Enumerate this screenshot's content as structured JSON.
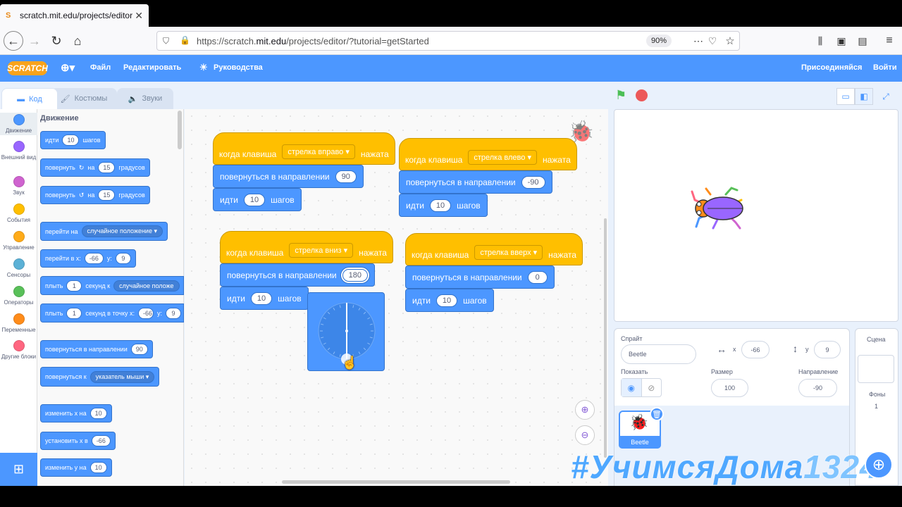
{
  "browser": {
    "tab_title": "scratch.mit.edu/projects/editor",
    "url_prefix": "https://scratch.",
    "url_domain": "mit.edu",
    "url_suffix": "/projects/editor/?tutorial=getStarted",
    "zoom": "90%"
  },
  "menu": {
    "logo": "SCRATCH",
    "file": "Файл",
    "edit": "Редактировать",
    "tutorials": "Руководства",
    "join": "Присоединяйся",
    "login": "Войти"
  },
  "tabs": {
    "code": "Код",
    "costumes": "Костюмы",
    "sounds": "Звуки"
  },
  "categories": [
    {
      "label": "Движение",
      "color": "#4c97ff"
    },
    {
      "label": "Внешний вид",
      "color": "#9966ff"
    },
    {
      "label": "Звук",
      "color": "#cf63cf"
    },
    {
      "label": "События",
      "color": "#ffbf00"
    },
    {
      "label": "Управление",
      "color": "#ffab19"
    },
    {
      "label": "Сенсоры",
      "color": "#5cb1d6"
    },
    {
      "label": "Операторы",
      "color": "#59c059"
    },
    {
      "label": "Переменные",
      "color": "#ff8c1a"
    },
    {
      "label": "Другие блоки",
      "color": "#ff6680"
    }
  ],
  "palette": {
    "title": "Движение",
    "move": {
      "a": "идти",
      "n": "10",
      "b": "шагов"
    },
    "turn_right": {
      "a": "повернуть",
      "b": "на",
      "n": "15",
      "c": "градусов"
    },
    "turn_left": {
      "a": "повернуть",
      "b": "на",
      "n": "15",
      "c": "градусов"
    },
    "goto": {
      "a": "перейти на",
      "dd": "случайное положение"
    },
    "goto_xy": {
      "a": "перейти в x:",
      "x": "-66",
      "b": "y:",
      "y": "9"
    },
    "glide": {
      "a": "плыть",
      "n": "1",
      "b": "секунд к",
      "dd": "случайное положе"
    },
    "glide_xy": {
      "a": "плыть",
      "n": "1",
      "b": "секунд в точку x:",
      "x": "-66",
      "c": "y:",
      "y": "9"
    },
    "point_dir": {
      "a": "повернуться в направлении",
      "n": "90"
    },
    "point_to": {
      "a": "повернуться к",
      "dd": "указатель мыши"
    },
    "change_x": {
      "a": "изменить х на",
      "n": "10"
    },
    "set_x": {
      "a": "установить х в",
      "n": "-66"
    },
    "change_y": {
      "a": "изменить у на",
      "n": "10"
    }
  },
  "scripts": [
    {
      "hat_a": "когда клавиша",
      "key": "стрелка вправо",
      "hat_b": "нажата",
      "dir_label": "повернуться в направлении",
      "dir": "90",
      "move_a": "идти",
      "steps": "10",
      "move_b": "шагов"
    },
    {
      "hat_a": "когда клавиша",
      "key": "стрелка влево",
      "hat_b": "нажата",
      "dir_label": "повернуться в направлении",
      "dir": "-90",
      "move_a": "идти",
      "steps": "10",
      "move_b": "шагов"
    },
    {
      "hat_a": "когда клавиша",
      "key": "стрелка вниз",
      "hat_b": "нажата",
      "dir_label": "повернуться в направлении",
      "dir": "180",
      "move_a": "идти",
      "steps": "10",
      "move_b": "шагов"
    },
    {
      "hat_a": "когда клавиша",
      "key": "стрелка вверх",
      "hat_b": "нажата",
      "dir_label": "повернуться в направлении",
      "dir": "0",
      "move_a": "идти",
      "steps": "10",
      "move_b": "шагов"
    }
  ],
  "sprite_info": {
    "sprite_label": "Спрайт",
    "name": "Beetle",
    "x_label": "x",
    "x": "-66",
    "y_label": "y",
    "y": "9",
    "show_label": "Показать",
    "size_label": "Размер",
    "size": "100",
    "direction_label": "Направление",
    "direction": "-90",
    "thumb_name": "Beetle"
  },
  "stage_pane": {
    "title": "Сцена",
    "backdrops_label": "Фоны",
    "backdrops_count": "1"
  },
  "watermark": {
    "a": "#УчимсяДома",
    "b": "1324"
  },
  "colors": {
    "motion": "#4c97ff",
    "events": "#ffbf00",
    "menubar": "#4c97ff"
  }
}
